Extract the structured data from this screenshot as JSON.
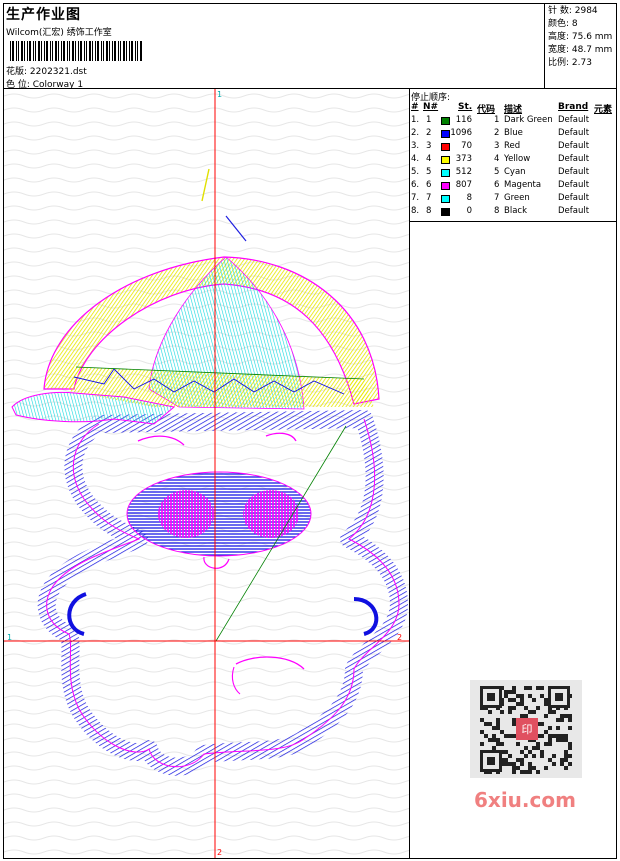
{
  "header": {
    "title": "生产作业图",
    "company": "Wilcom(汇宏) 绣饰工作室",
    "design_label": "花版: 2202321.dst",
    "colorway_label": "色 位:  Colorway 1"
  },
  "stats": {
    "stitches": "针 数: 2984",
    "colors": "颜色: 8",
    "height": "高度: 75.6 mm",
    "width": "宽度: 48.7 mm",
    "scale": "比例: 2.73"
  },
  "crosshair": {
    "top": "1",
    "bottom": "2",
    "left": "1",
    "right": "2"
  },
  "sequence": {
    "title": "停止顺序:",
    "headers": [
      "#",
      "N#",
      "St.",
      "代码",
      "描述",
      "Brand",
      "元素"
    ],
    "rows": [
      {
        "idx": "1.",
        "n": "1",
        "color": "#008000",
        "st": "116",
        "code": "1",
        "desc": "Dark Green",
        "brand": "Default"
      },
      {
        "idx": "2.",
        "n": "2",
        "color": "#0000ff",
        "st": "1096",
        "code": "2",
        "desc": "Blue",
        "brand": "Default"
      },
      {
        "idx": "3.",
        "n": "3",
        "color": "#ff0000",
        "st": "70",
        "code": "3",
        "desc": "Red",
        "brand": "Default"
      },
      {
        "idx": "4.",
        "n": "4",
        "color": "#ffff00",
        "st": "373",
        "code": "4",
        "desc": "Yellow",
        "brand": "Default"
      },
      {
        "idx": "5.",
        "n": "5",
        "color": "#00ffff",
        "st": "512",
        "code": "5",
        "desc": "Cyan",
        "brand": "Default"
      },
      {
        "idx": "6.",
        "n": "6",
        "color": "#ff00ff",
        "st": "807",
        "code": "6",
        "desc": "Magenta",
        "brand": "Default"
      },
      {
        "idx": "7.",
        "n": "7",
        "color": "#00ffff",
        "st": "8",
        "code": "7",
        "desc": "Green",
        "brand": "Default"
      },
      {
        "idx": "8.",
        "n": "8",
        "color": "#000000",
        "st": "0",
        "code": "8",
        "desc": "Black",
        "brand": "Default"
      }
    ]
  },
  "watermark": {
    "site": "6xiu.com",
    "stamp": "印"
  }
}
